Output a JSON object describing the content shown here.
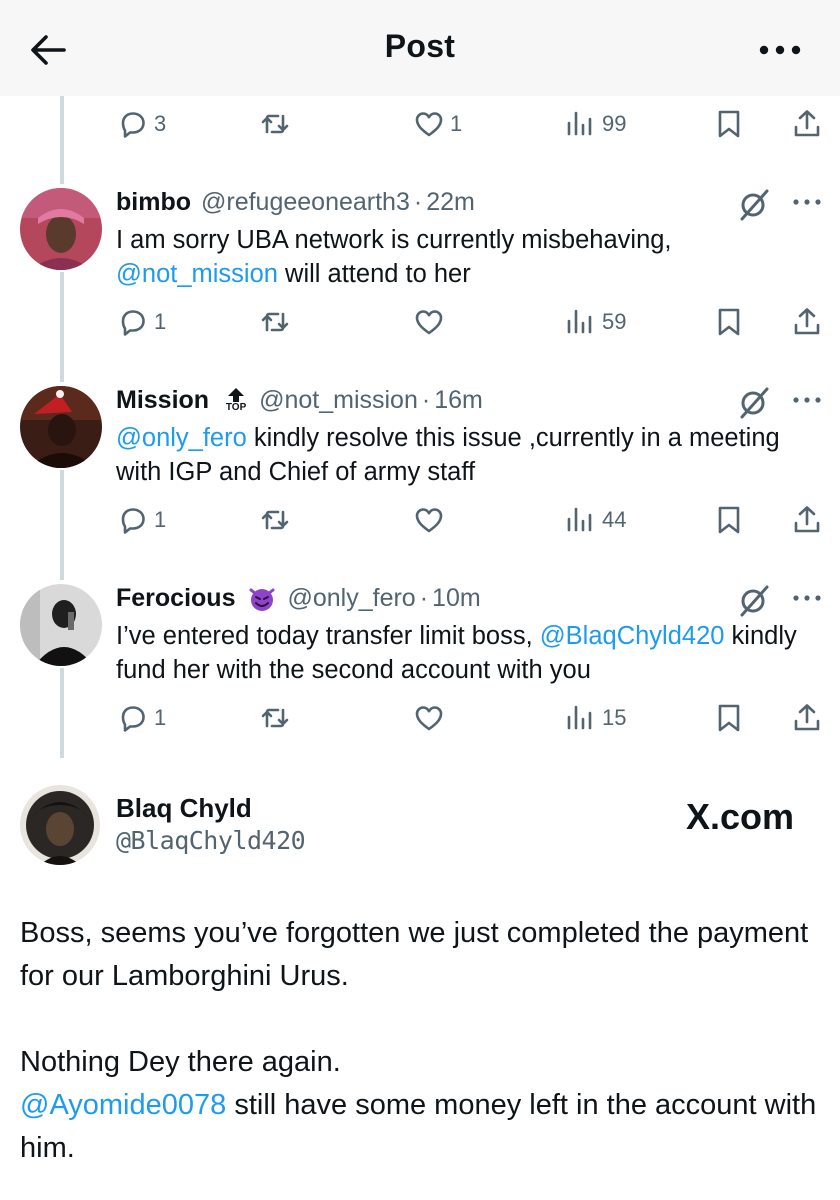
{
  "header": {
    "title": "Post",
    "back_icon": "arrow-left-icon",
    "more_icon": "more-horizontal-icon"
  },
  "previous_actions": {
    "replies": "3",
    "reposts": "",
    "likes": "1",
    "views": "99"
  },
  "replies": [
    {
      "name": "bimbo",
      "handle": "@refugeeonearth3",
      "time": "22m",
      "text_before": "I am sorry UBA network is currently misbehaving,",
      "mention": "@not_mission",
      "text_after": " will attend to her",
      "actions": {
        "replies": "1",
        "reposts": "",
        "likes": "",
        "views": "59"
      }
    },
    {
      "name": "Mission",
      "badge": "TOP",
      "handle": "@not_mission",
      "time": "16m",
      "mention": "@only_fero",
      "text_after": " kindly resolve this issue ,currently in a meeting with IGP and Chief of army staff",
      "actions": {
        "replies": "1",
        "reposts": "",
        "likes": "",
        "views": "44"
      }
    },
    {
      "name": "Ferocious",
      "emoji": "smiling-devil-emoji",
      "handle": "@only_fero",
      "time": "10m",
      "text_before": "I’ve entered today transfer limit boss, ",
      "mention": "@BlaqChyld420",
      "text_after": " kindly fund her with the second account with you",
      "actions": {
        "replies": "1",
        "reposts": "",
        "likes": "",
        "views": "15"
      }
    }
  ],
  "main_post": {
    "name": "Blaq Chyld",
    "handle": "@BlaqChyld420",
    "watermark": "X.com",
    "para1": "Boss, seems you’ve forgotten we just completed the payment for our Lamborghini Urus.",
    "para2": "Nothing Dey there again.",
    "mention": "@Ayomide0078",
    "para3_after": " still have some money left in the account with him."
  },
  "colors": {
    "accent": "#1d9bf0",
    "secondary_text": "#536471",
    "thread_line": "#cfd9de",
    "header_bg": "#f7f7f7"
  }
}
